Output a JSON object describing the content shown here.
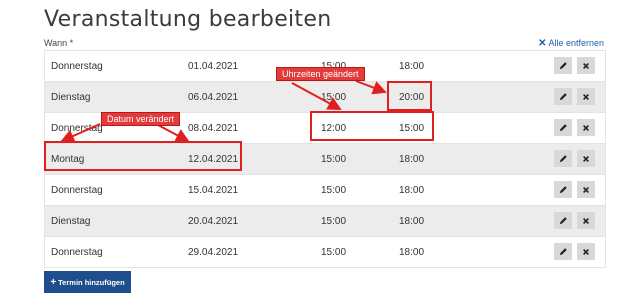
{
  "page": {
    "title": "Veranstaltung bearbeiten",
    "when_label": "Wann *",
    "remove_all": "Alle entfernen"
  },
  "rows": [
    {
      "day": "Donnerstag",
      "date": "01.04.2021",
      "from": "15:00",
      "to": "18:00"
    },
    {
      "day": "Dienstag",
      "date": "06.04.2021",
      "from": "15:00",
      "to": "20:00"
    },
    {
      "day": "Donnerstag",
      "date": "08.04.2021",
      "from": "12:00",
      "to": "15:00"
    },
    {
      "day": "Montag",
      "date": "12.04.2021",
      "from": "15:00",
      "to": "18:00"
    },
    {
      "day": "Donnerstag",
      "date": "15.04.2021",
      "from": "15:00",
      "to": "18:00"
    },
    {
      "day": "Dienstag",
      "date": "20.04.2021",
      "from": "15:00",
      "to": "18:00"
    },
    {
      "day": "Donnerstag",
      "date": "29.04.2021",
      "from": "15:00",
      "to": "18:00"
    }
  ],
  "row_actions": {
    "edit_icon": "pencil-icon",
    "delete_icon": "close-icon"
  },
  "add_button": {
    "label": "Termin hinzufügen",
    "icon": "plus-icon"
  },
  "annotations": {
    "times_changed": "Uhrzeiten geändert",
    "date_changed": "Datum verändert"
  },
  "colors": {
    "accent_blue": "#1f4e8c",
    "link_blue": "#1f5fa8",
    "annotation_red": "#e02020",
    "row_alt_bg": "#ececec",
    "action_button_bg": "#d8d8d8"
  }
}
